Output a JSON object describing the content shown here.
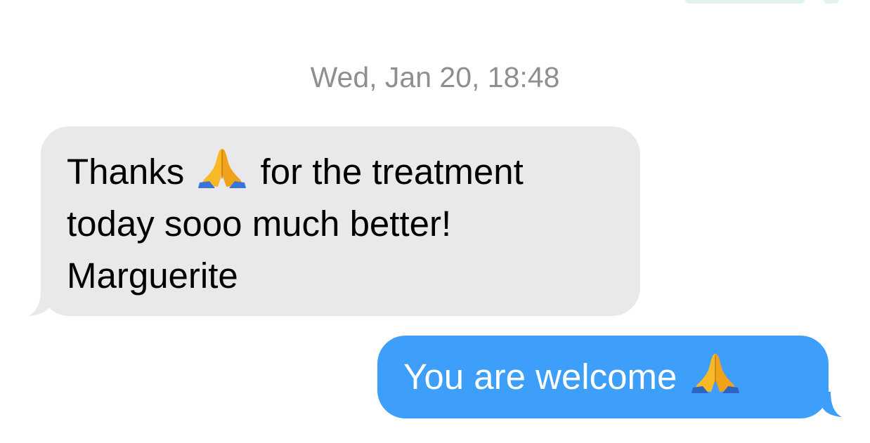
{
  "conversation": {
    "timestamp": "Wed, Jan 20, 18:48",
    "messages": [
      {
        "direction": "incoming",
        "lines": [
          {
            "before_emoji": "Thanks",
            "emoji": "folded-hands",
            "after_emoji": "for the treatment"
          },
          {
            "text": "today sooo much better!"
          },
          {
            "text": "Marguerite"
          }
        ],
        "bubble_color": "#e9e9eb",
        "text_color": "#000000"
      },
      {
        "direction": "outgoing",
        "text": "You are welcome",
        "emoji": "folded-hands",
        "bubble_color": "#3e9ffb",
        "text_color": "#ffffff"
      }
    ]
  },
  "colors": {
    "timestamp": "#8e8e93",
    "background": "#ffffff"
  }
}
